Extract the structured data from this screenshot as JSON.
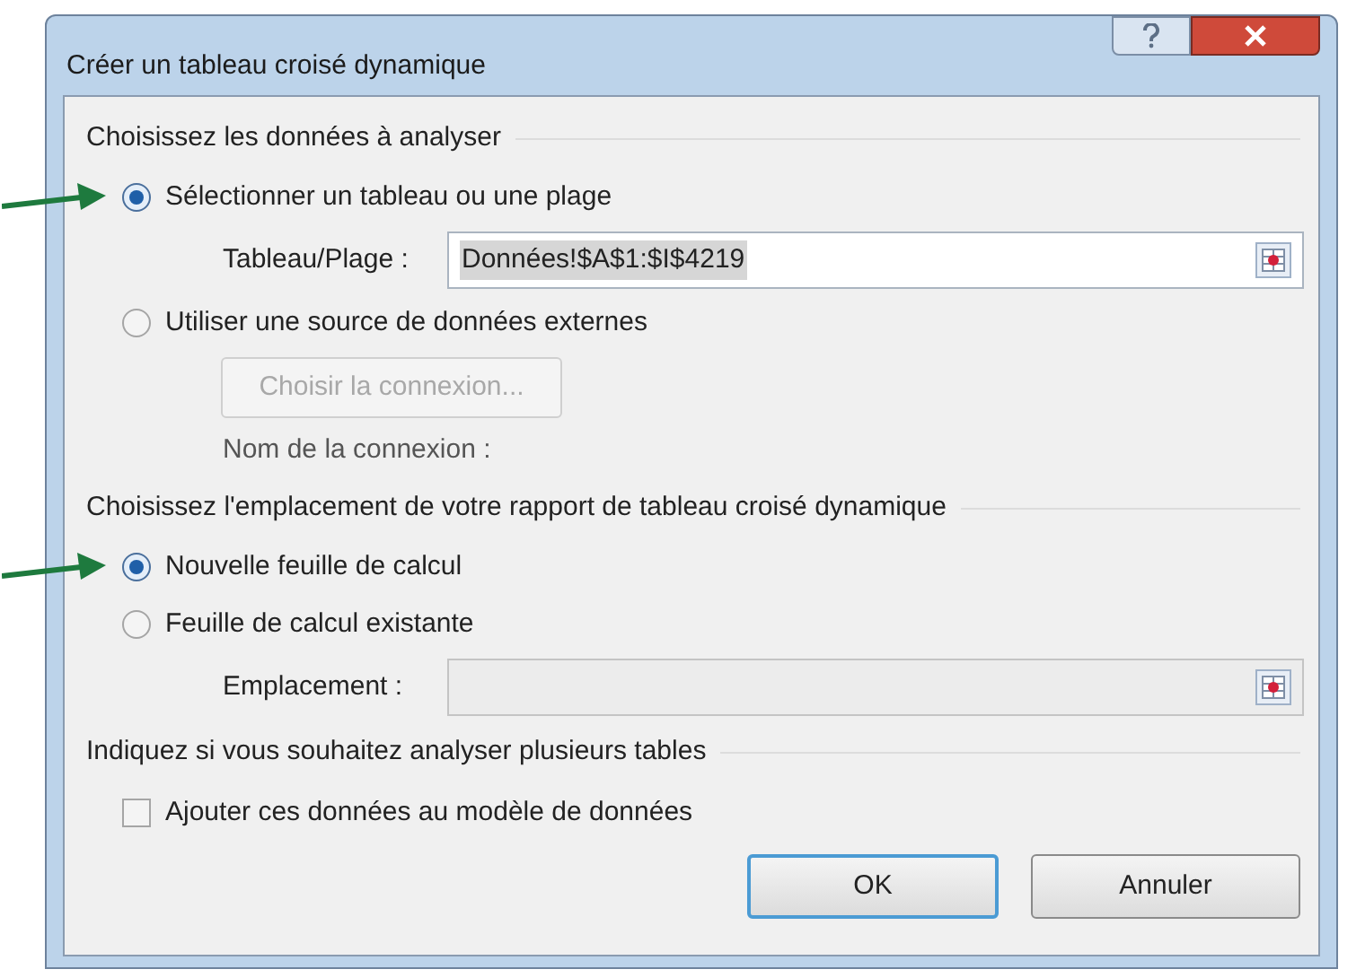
{
  "window": {
    "title": "Créer un tableau croisé dynamique"
  },
  "sections": [
    {
      "heading": "Choisissez les données à analyser",
      "items": [
        {
          "kind": "radio",
          "label": "Sélectionner un tableau ou une plage",
          "selected": true,
          "annotated": true
        },
        {
          "kind": "field",
          "label": "Tableau/Plage :",
          "value": "Données!$A$1:$I$4219",
          "disabled": false
        },
        {
          "kind": "radio",
          "label": "Utiliser une source de données externes",
          "selected": false,
          "annotated": false
        },
        {
          "kind": "button",
          "label": "Choisir la connexion...",
          "disabled": true
        },
        {
          "kind": "text",
          "label": "Nom de la connexion :"
        }
      ]
    },
    {
      "heading": "Choisissez l'emplacement de votre rapport de tableau croisé dynamique",
      "items": [
        {
          "kind": "radio",
          "label": "Nouvelle feuille de calcul",
          "selected": true,
          "annotated": true
        },
        {
          "kind": "radio",
          "label": "Feuille de calcul existante",
          "selected": false,
          "annotated": false
        },
        {
          "kind": "field",
          "label": "Emplacement :",
          "disabled": true
        }
      ]
    },
    {
      "heading": "Indiquez si vous souhaitez analyser plusieurs tables",
      "items": [
        {
          "kind": "checkbox",
          "label": "Ajouter ces données au modèle de données",
          "checked": false
        }
      ]
    }
  ],
  "buttons": [
    {
      "label": "OK",
      "default": true
    },
    {
      "label": "Annuler",
      "default": false
    }
  ]
}
